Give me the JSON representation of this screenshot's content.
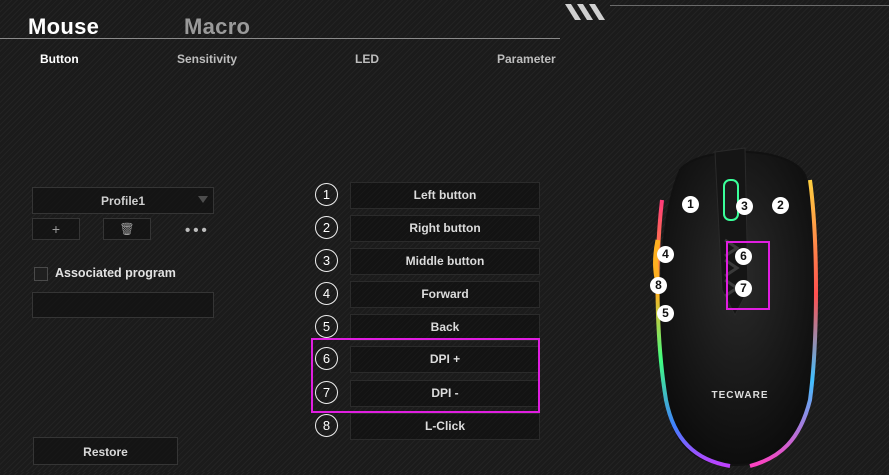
{
  "tabs": {
    "mouse": "Mouse",
    "macro": "Macro"
  },
  "subtabs": {
    "button": "Button",
    "sensitivity": "Sensitivity",
    "led": "LED",
    "parameter": "Parameter"
  },
  "left_panel": {
    "profile": "Profile1",
    "add_symbol": "+",
    "delete_symbol": "🗑",
    "more_symbol": "•••",
    "associated_program_label": "Associated program",
    "associated_program_value": "",
    "restore_label": "Restore"
  },
  "button_list": [
    {
      "number": "1",
      "label": "Left button"
    },
    {
      "number": "2",
      "label": "Right button"
    },
    {
      "number": "3",
      "label": "Middle button"
    },
    {
      "number": "4",
      "label": "Forward"
    },
    {
      "number": "5",
      "label": "Back"
    },
    {
      "number": "6",
      "label": "DPI +"
    },
    {
      "number": "7",
      "label": "DPI -"
    },
    {
      "number": "8",
      "label": "L-Click"
    }
  ],
  "mouse_image": {
    "brand": "TECWARE",
    "button_markers": [
      "1",
      "2",
      "3",
      "4",
      "5",
      "6",
      "7",
      "8"
    ]
  },
  "colors": {
    "highlight": "#e01ee0",
    "background": "#1b1b1b"
  }
}
